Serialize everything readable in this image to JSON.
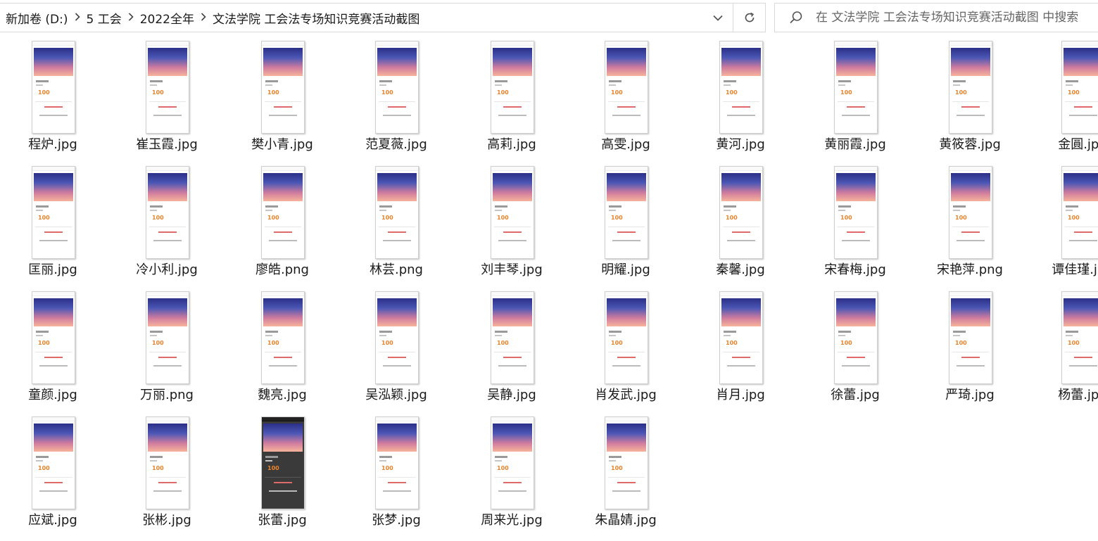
{
  "address_bar": {
    "breadcrumbs": [
      "新加卷 (D:)",
      "5 工会",
      "2022全年",
      "文法学院 工会法专场知识竞赛活动截图"
    ],
    "separator_icon": "chevron-right-icon",
    "dropdown_icon": "chevron-down-icon",
    "refresh_icon": "refresh-icon"
  },
  "search": {
    "placeholder": "在 文法学院 工会法专场知识竞赛活动截图 中搜索",
    "icon": "search-icon"
  },
  "files": [
    "程炉.jpg",
    "崔玉霞.jpg",
    "樊小青.jpg",
    "范夏薇.jpg",
    "高莉.jpg",
    "高雯.jpg",
    "黄河.jpg",
    "黄丽霞.jpg",
    "黄筱蓉.jpg",
    "金圓.jpg",
    "匡丽.jpg",
    "冷小利.jpg",
    "廖皓.png",
    "林芸.png",
    "刘丰琴.jpg",
    "明耀.jpg",
    "秦馨.jpg",
    "宋春梅.jpg",
    "宋艳萍.png",
    "谭佳瑾.jpg",
    "童颜.jpg",
    "万丽.png",
    "魏亮.jpg",
    "吴泓颖.jpg",
    "吴静.jpg",
    "肖发武.jpg",
    "肖月.jpg",
    "徐蕾.jpg",
    "严琦.jpg",
    "杨蕾.jpg",
    "应斌.jpg",
    "张彬.jpg",
    "张蕾.jpg",
    "张梦.jpg",
    "周来光.jpg",
    "朱晶婧.jpg"
  ],
  "thumbnail_score": "100"
}
